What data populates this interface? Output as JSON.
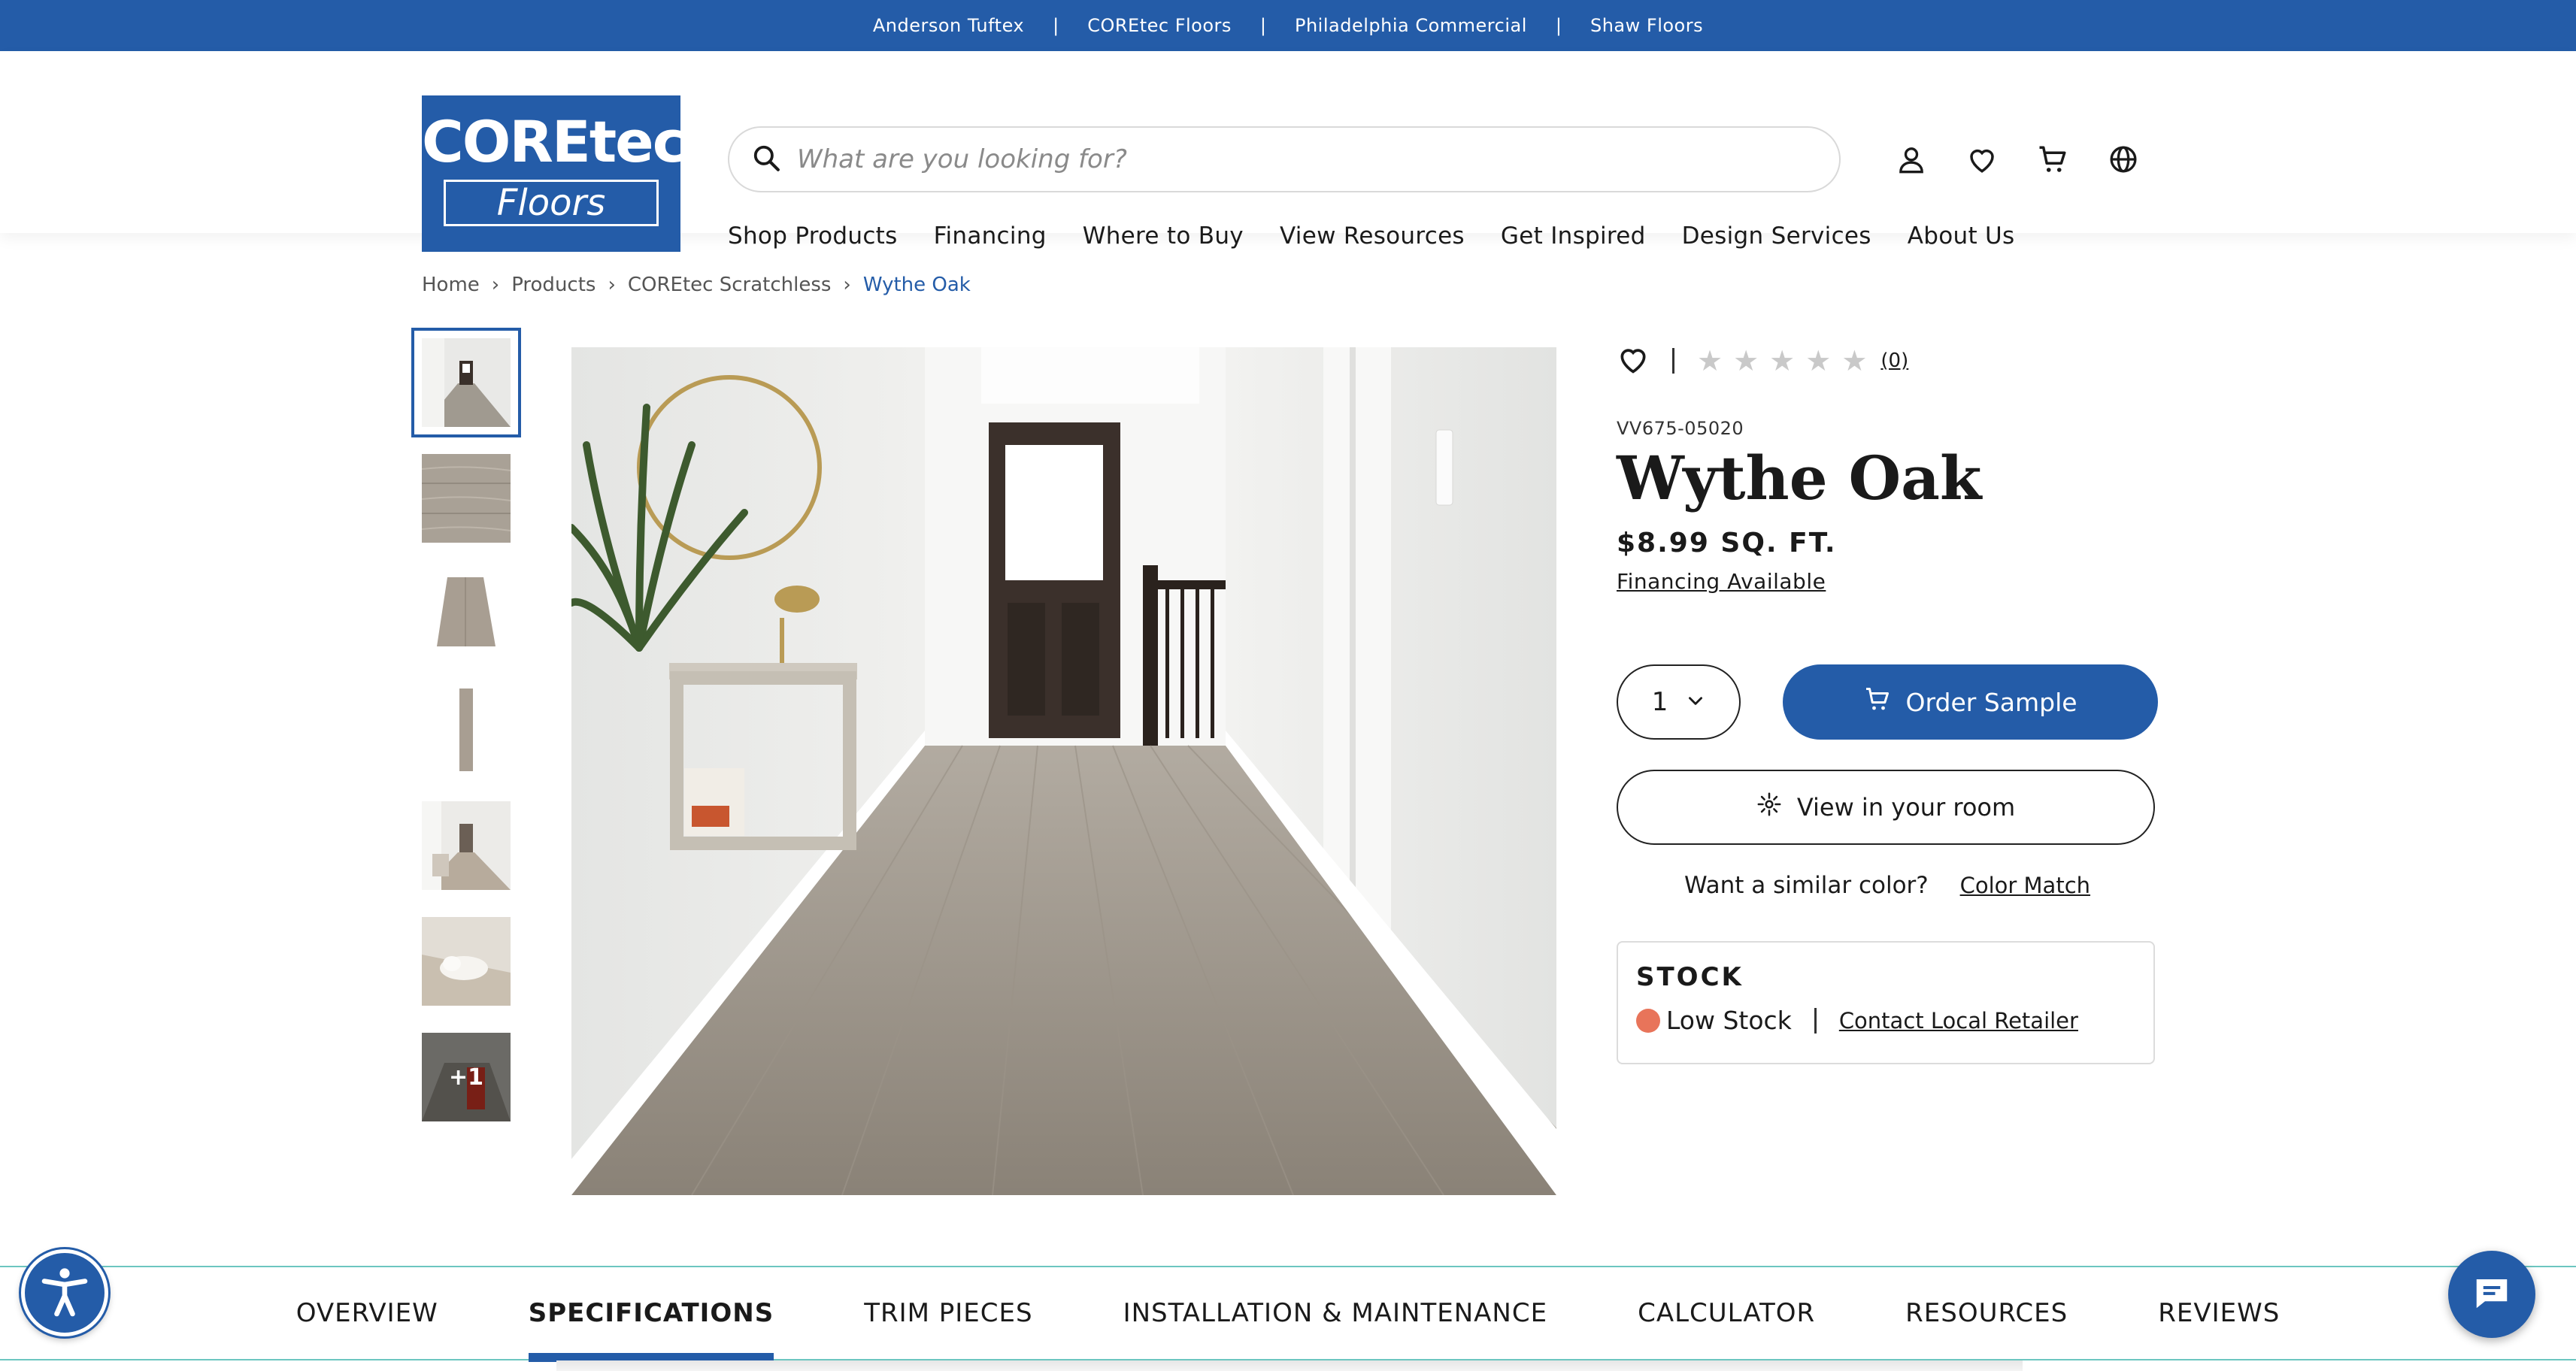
{
  "topbar": {
    "links": [
      "Anderson Tuftex",
      "COREtec Floors",
      "Philadelphia Commercial",
      "Shaw Floors"
    ],
    "separator": "|"
  },
  "logo": {
    "brand": "COREtec",
    "reg": "®",
    "sub": "Floors"
  },
  "search": {
    "placeholder": "What are you looking for?"
  },
  "nav": [
    "Shop Products",
    "Financing",
    "Where to Buy",
    "View Resources",
    "Get Inspired",
    "Design Services",
    "About Us"
  ],
  "breadcrumb": [
    "Home",
    "Products",
    "COREtec Scratchless",
    "Wythe Oak"
  ],
  "thumbnails": {
    "more_label": "+1"
  },
  "product": {
    "rating_count": "(0)",
    "stars": 0,
    "sku": "VV675-05020",
    "name": "Wythe Oak",
    "price": "$8.99 SQ. FT.",
    "financing": "Financing Available",
    "qty": "1",
    "order_label": "Order Sample",
    "room_label": "View in your room",
    "similar_text": "Want a similar color?",
    "color_match": "Color Match"
  },
  "stock": {
    "heading": "STOCK",
    "status": "Low Stock",
    "contact": "Contact Local Retailer",
    "status_color": "#e8745a"
  },
  "tabs": [
    "OVERVIEW",
    "SPECIFICATIONS",
    "TRIM PIECES",
    "INSTALLATION & MAINTENANCE",
    "CALCULATOR",
    "RESOURCES",
    "REVIEWS"
  ],
  "active_tab": "SPECIFICATIONS",
  "colors": {
    "brand": "#245ca8",
    "tab_border": "#6cc6c0"
  }
}
